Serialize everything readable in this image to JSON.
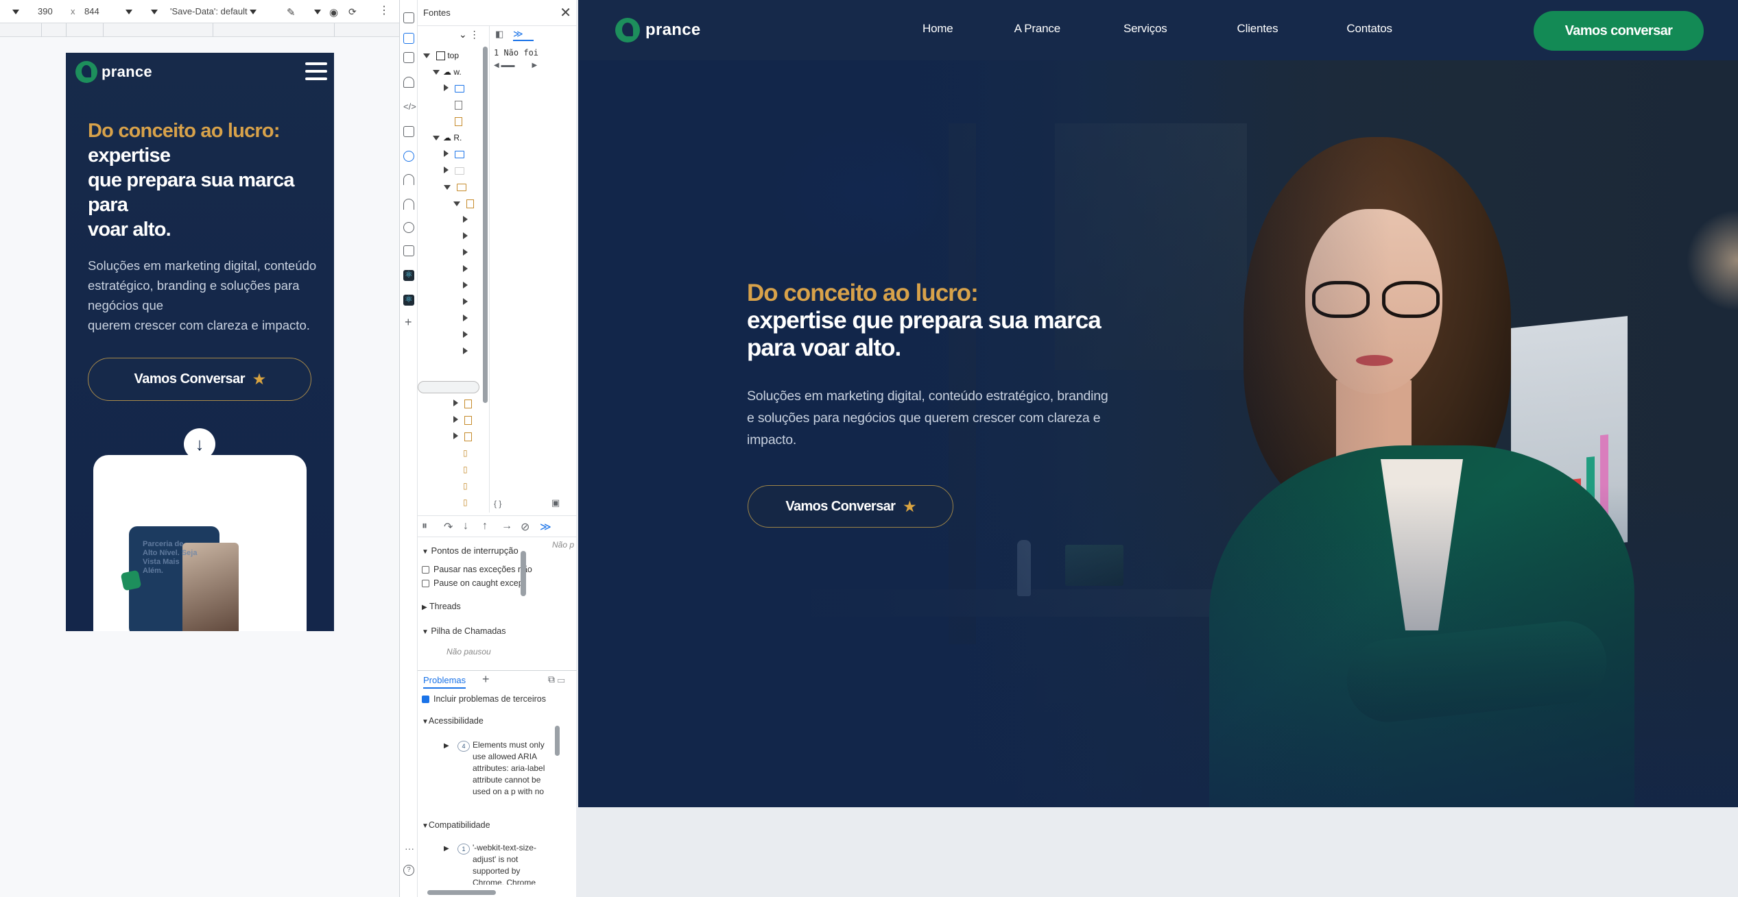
{
  "device_toolbar": {
    "width": "390",
    "times": "x",
    "height": "844",
    "save_data": "'Save-Data': default"
  },
  "mobile": {
    "logo_text": "prance",
    "hero_title_gold": "Do conceito ao lucro:",
    "hero_title_white": "expertise\nque prepara sua marca\npara\nvoar alto.",
    "hero_sub": "Soluções em marketing digital, conteúdo estratégico, branding e soluções para negócios que\nquerem crescer com clareza e impacto.",
    "cta": "Vamos Conversar",
    "card_text": "Parceria de Alto Nível. Seja Vista Mais Além."
  },
  "devtools": {
    "panel_title": "Fontes",
    "tree": {
      "top": "top"
    },
    "code_line": "1  Não foi",
    "breakpoints": {
      "title": "Pontos de interrupção",
      "pause_exceptions": "Pausar nas exceções não",
      "pause_caught": "Pause on caught excep",
      "threads": "Threads",
      "call_stack": "Pilha de Chamadas",
      "not_paused": "Não pausou",
      "side_hint": "Não p"
    },
    "problems": {
      "tab": "Problemas",
      "include_third_party": "Incluir problemas de terceiros",
      "accessibility": "Acessibilidade",
      "accessibility_count": "4",
      "accessibility_issue": "Elements must only use allowed ARIA attributes: aria-label attribute cannot be used on a p with no valid role attribute.",
      "compatibility": "Compatibilidade",
      "compat_count": "1",
      "compat_issue": "'-webkit-text-size-adjust' is not supported by Chrome, Chrome"
    }
  },
  "site": {
    "logo_text": "prance",
    "nav": [
      "Home",
      "A Prance",
      "Serviços",
      "Clientes",
      "Contatos"
    ],
    "header_cta": "Vamos conversar",
    "hero_title_gold": "Do conceito ao lucro:",
    "hero_title_white": "expertise que prepara sua marca\npara voar alto.",
    "hero_sub": "Soluções em marketing digital, conteúdo estratégico, branding\ne soluções para negócios que querem crescer com clareza e\nimpacto.",
    "hero_cta": "Vamos Conversar",
    "colors": {
      "navy": "#16294a",
      "gold": "#d8a24a",
      "green": "#138a55"
    }
  }
}
